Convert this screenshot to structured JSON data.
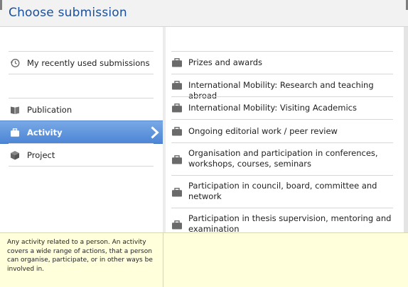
{
  "dialog": {
    "title": "Choose submission"
  },
  "left": {
    "items": [
      {
        "label": "My recently used submissions",
        "icon": "history-icon",
        "selected": false
      },
      {
        "label": "Publication",
        "icon": "book-icon",
        "selected": false
      },
      {
        "label": "Activity",
        "icon": "briefcase-icon",
        "selected": true
      },
      {
        "label": "Project",
        "icon": "cube-icon",
        "selected": false
      }
    ]
  },
  "right": {
    "items": [
      {
        "label": "Prizes and awards",
        "icon": "briefcase-icon"
      },
      {
        "label": "International Mobility: Research and teaching abroad",
        "icon": "briefcase-icon"
      },
      {
        "label": "International Mobility: Visiting Academics",
        "icon": "briefcase-icon"
      },
      {
        "label": "Ongoing editorial work / peer review",
        "icon": "briefcase-icon"
      },
      {
        "label": "Organisation and participation in conferences, workshops, courses, seminars",
        "icon": "briefcase-icon"
      },
      {
        "label": "Participation in council, board, committee and network",
        "icon": "briefcase-icon"
      },
      {
        "label": "Participation in thesis supervision, mentoring and examination",
        "icon": "briefcase-icon"
      }
    ]
  },
  "footer": {
    "description": "Any activity related to a person. An activity covers a wide range of actions, that a person can organise, participate, or in other ways be involved in."
  },
  "colors": {
    "title": "#1a4f9c",
    "selected": "#5b92dc",
    "footer": "#ffffdc"
  }
}
